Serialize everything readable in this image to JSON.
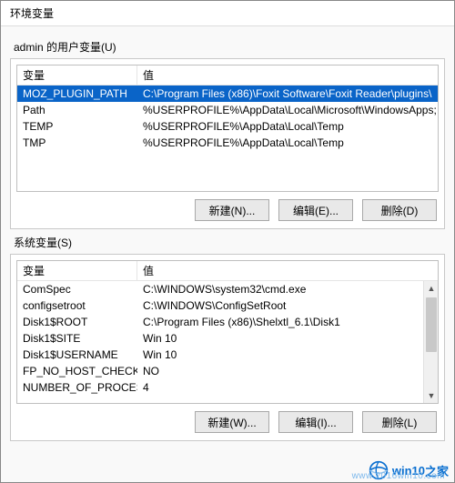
{
  "window": {
    "title": "环境变量"
  },
  "user_section": {
    "label": "admin 的用户变量(U)",
    "headers": {
      "name": "变量",
      "value": "值"
    },
    "rows": [
      {
        "name": "MOZ_PLUGIN_PATH",
        "value": "C:\\Program Files (x86)\\Foxit Software\\Foxit Reader\\plugins\\",
        "selected": true
      },
      {
        "name": "Path",
        "value": "%USERPROFILE%\\AppData\\Local\\Microsoft\\WindowsApps;",
        "selected": false
      },
      {
        "name": "TEMP",
        "value": "%USERPROFILE%\\AppData\\Local\\Temp",
        "selected": false
      },
      {
        "name": "TMP",
        "value": "%USERPROFILE%\\AppData\\Local\\Temp",
        "selected": false
      }
    ],
    "buttons": {
      "new": "新建(N)...",
      "edit": "编辑(E)...",
      "delete": "删除(D)"
    }
  },
  "system_section": {
    "label": "系统变量(S)",
    "headers": {
      "name": "变量",
      "value": "值"
    },
    "rows": [
      {
        "name": "ComSpec",
        "value": "C:\\WINDOWS\\system32\\cmd.exe"
      },
      {
        "name": "configsetroot",
        "value": "C:\\WINDOWS\\ConfigSetRoot"
      },
      {
        "name": "Disk1$ROOT",
        "value": "C:\\Program Files (x86)\\Shelxtl_6.1\\Disk1"
      },
      {
        "name": "Disk1$SITE",
        "value": "Win 10"
      },
      {
        "name": "Disk1$USERNAME",
        "value": "Win 10"
      },
      {
        "name": "FP_NO_HOST_CHECK",
        "value": "NO"
      },
      {
        "name": "NUMBER_OF_PROCESSORS",
        "value": "4"
      }
    ],
    "buttons": {
      "new": "新建(W)...",
      "edit": "编辑(I)...",
      "delete": "删除(L)"
    }
  },
  "watermark": {
    "brand_a": "win10",
    "brand_b": "之家",
    "url": "www.2016win10.com"
  },
  "colors": {
    "selection_bg": "#0a64c8",
    "selection_fg": "#ffffff"
  }
}
